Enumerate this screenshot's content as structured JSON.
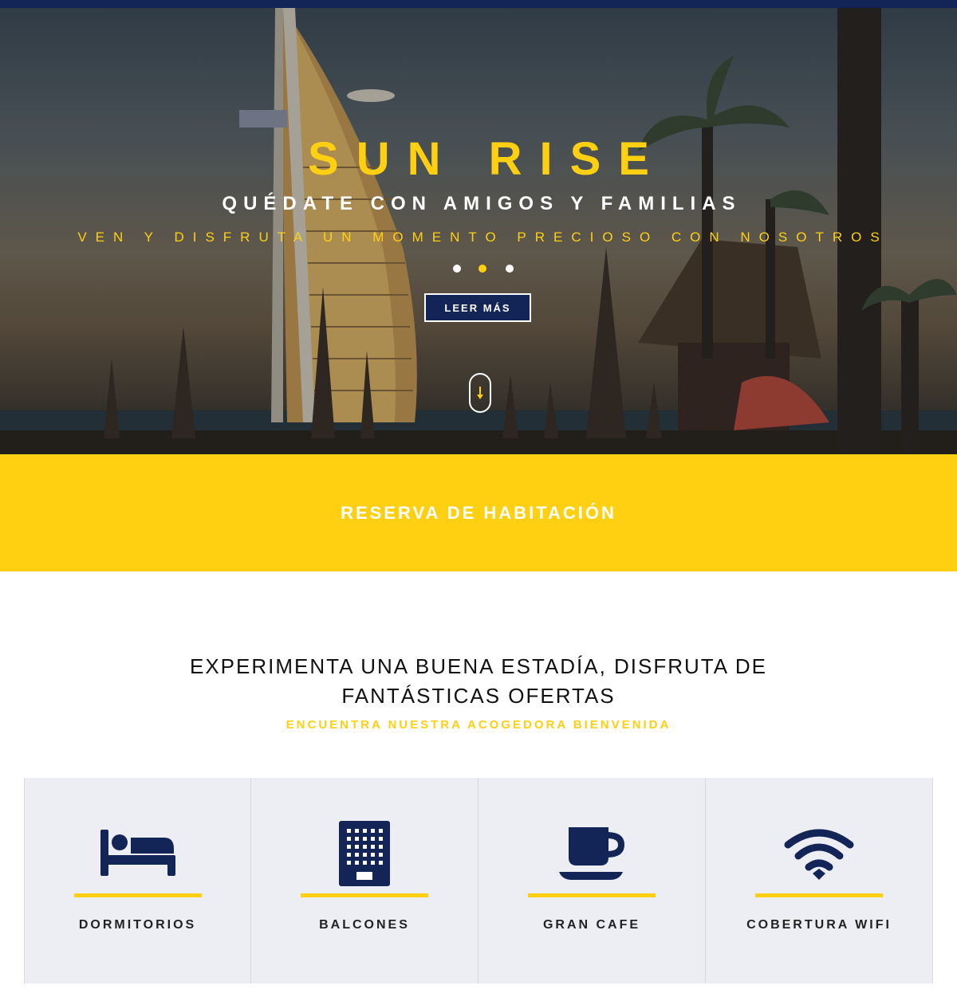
{
  "hero": {
    "title": "SUN RISE",
    "subtitle": "QUÉDATE CON AMIGOS Y FAMILIAS",
    "tagline": "VEN Y DISFRUTA UN MOMENTO PRECIOSO CON NOSOTROS",
    "read_more": "LEER MÁS",
    "slides": {
      "count": 3,
      "active": 2
    }
  },
  "booking": {
    "label": "RESERVA DE HABITACIÓN"
  },
  "intro": {
    "title": "EXPERIMENTA UNA BUENA ESTADÍA, DISFRUTA DE FANTÁSTICAS OFERTAS",
    "subtitle": "ENCUENTRA NUESTRA ACOGEDORA BIENVENIDA"
  },
  "features": [
    {
      "label": "DORMITORIOS",
      "icon": "bed-icon"
    },
    {
      "label": "BALCONES",
      "icon": "building-icon"
    },
    {
      "label": "GRAN CAFE",
      "icon": "coffee-cup-icon"
    },
    {
      "label": "COBERTURA WIFI",
      "icon": "wifi-icon"
    }
  ],
  "colors": {
    "navy": "#132457",
    "yellow": "#ffd012",
    "panel": "#eceef3"
  }
}
